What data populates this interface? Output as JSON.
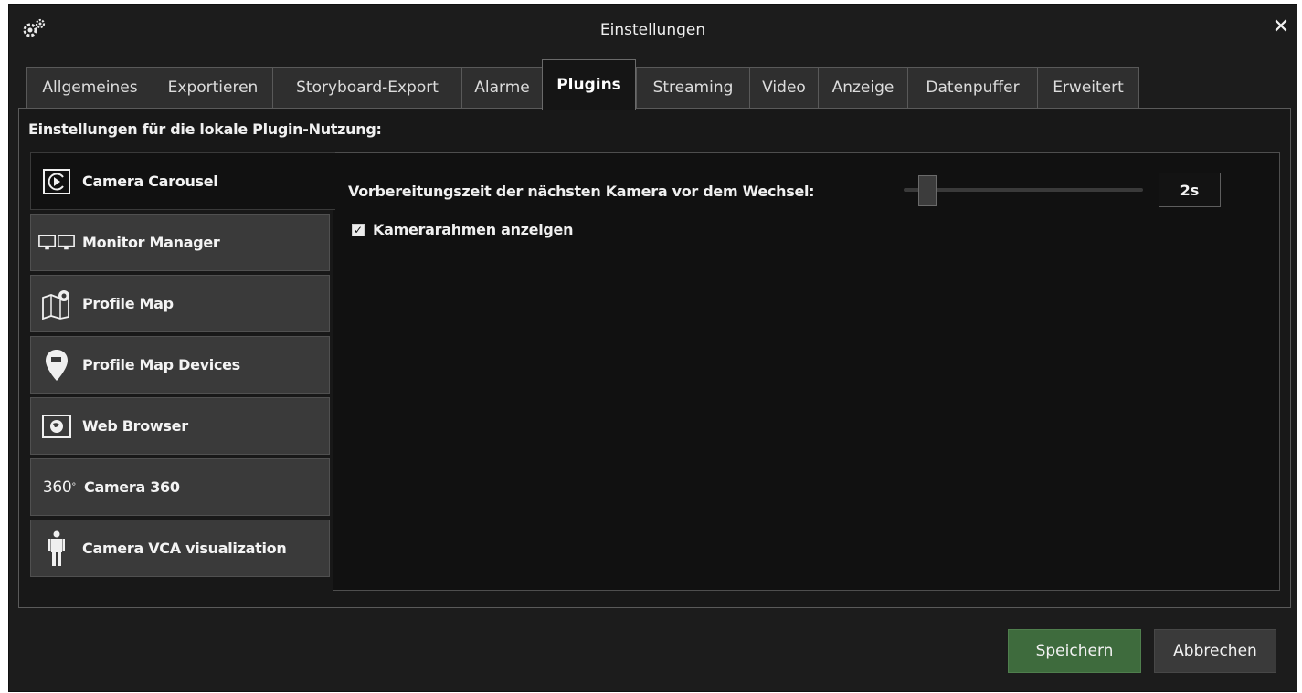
{
  "window": {
    "title": "Einstellungen",
    "close_symbol": "✕"
  },
  "tabs": [
    {
      "label": "Allgemeines"
    },
    {
      "label": "Exportieren"
    },
    {
      "label": "Storyboard-Export"
    },
    {
      "label": "Alarme"
    },
    {
      "label": "Plugins",
      "active": true
    },
    {
      "label": "Streaming"
    },
    {
      "label": "Video"
    },
    {
      "label": "Anzeige"
    },
    {
      "label": "Datenpuffer"
    },
    {
      "label": "Erweitert"
    }
  ],
  "panel": {
    "heading": "Einstellungen für die lokale Plugin-Nutzung:"
  },
  "plugins": [
    {
      "label": "Camera Carousel",
      "icon": "carousel-icon",
      "active": true
    },
    {
      "label": "Monitor Manager",
      "icon": "monitors-icon"
    },
    {
      "label": "Profile Map",
      "icon": "map-icon"
    },
    {
      "label": "Profile Map Devices",
      "icon": "map-pin-icon"
    },
    {
      "label": "Web Browser",
      "icon": "globe-icon"
    },
    {
      "label": "Camera 360",
      "icon": "360-icon",
      "icon_text": "360"
    },
    {
      "label": "Camera VCA visualization",
      "icon": "person-icon"
    }
  ],
  "settings": {
    "slider_label": "Vorbereitungszeit der nächsten Kamera vor dem Wechsel:",
    "slider_value": "2s",
    "checkbox_label": "Kamerarahmen anzeigen",
    "checkbox_checked": true
  },
  "buttons": {
    "save": "Speichern",
    "cancel": "Abbrechen"
  },
  "colors": {
    "background": "#1c1c1c",
    "save_button": "#3e6b3d",
    "cancel_button": "#3a3a3a"
  }
}
